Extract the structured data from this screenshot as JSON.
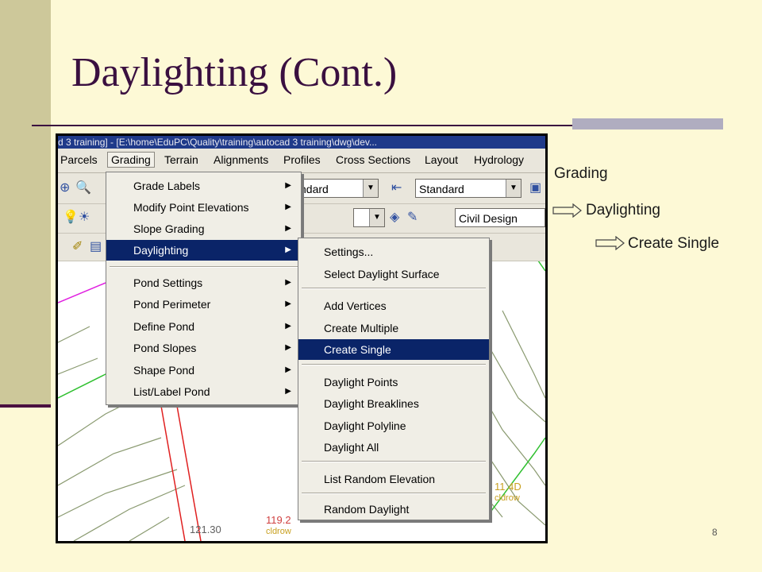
{
  "slide": {
    "title": "Daylighting (Cont.)",
    "page_number": "8"
  },
  "path": [
    "Grading",
    "Daylighting",
    "Create Single"
  ],
  "app": {
    "title_bar": "d 3 training] - [E:\\home\\EduPC\\Quality\\training\\autocad 3 training\\dwg\\dev...",
    "menubar": [
      "Parcels",
      "Grading",
      "Terrain",
      "Alignments",
      "Profiles",
      "Cross Sections",
      "Layout",
      "Hydrology"
    ],
    "toolbar": {
      "combo_left": "ndard",
      "combo_standard": "Standard",
      "combo_layer": "Civil Design"
    }
  },
  "grading_menu": {
    "items": [
      {
        "label": "Grade Labels",
        "submenu": true
      },
      {
        "label": "Modify Point Elevations",
        "submenu": true
      },
      {
        "label": "Slope Grading",
        "submenu": true
      },
      {
        "label": "Daylighting",
        "submenu": true,
        "selected": true
      },
      {
        "label": "Pond Settings",
        "submenu": true
      },
      {
        "label": "Pond Perimeter",
        "submenu": true
      },
      {
        "label": "Define Pond",
        "submenu": true
      },
      {
        "label": "Pond Slopes",
        "submenu": true
      },
      {
        "label": "Shape Pond",
        "submenu": true
      },
      {
        "label": "List/Label Pond",
        "submenu": true
      }
    ]
  },
  "daylighting_menu": {
    "items": [
      {
        "label": "Settings..."
      },
      {
        "label": "Select Daylight Surface"
      },
      {
        "label": "Add Vertices"
      },
      {
        "label": "Create Multiple"
      },
      {
        "label": "Create Single",
        "selected": true
      },
      {
        "label": "Daylight Points"
      },
      {
        "label": "Daylight Breaklines"
      },
      {
        "label": "Daylight Polyline"
      },
      {
        "label": "Daylight All"
      },
      {
        "label": "List Random Elevation"
      },
      {
        "label": "Random Daylight"
      }
    ]
  },
  "drawing": {
    "labels": [
      "121.30",
      "119.2",
      "11.4D",
      "cldrow",
      "cldrow"
    ]
  },
  "colors": {
    "background": "#fdf9d6",
    "sidebar": "#cdc89a",
    "title": "#3a1040",
    "menu_highlight": "#0a2468"
  }
}
